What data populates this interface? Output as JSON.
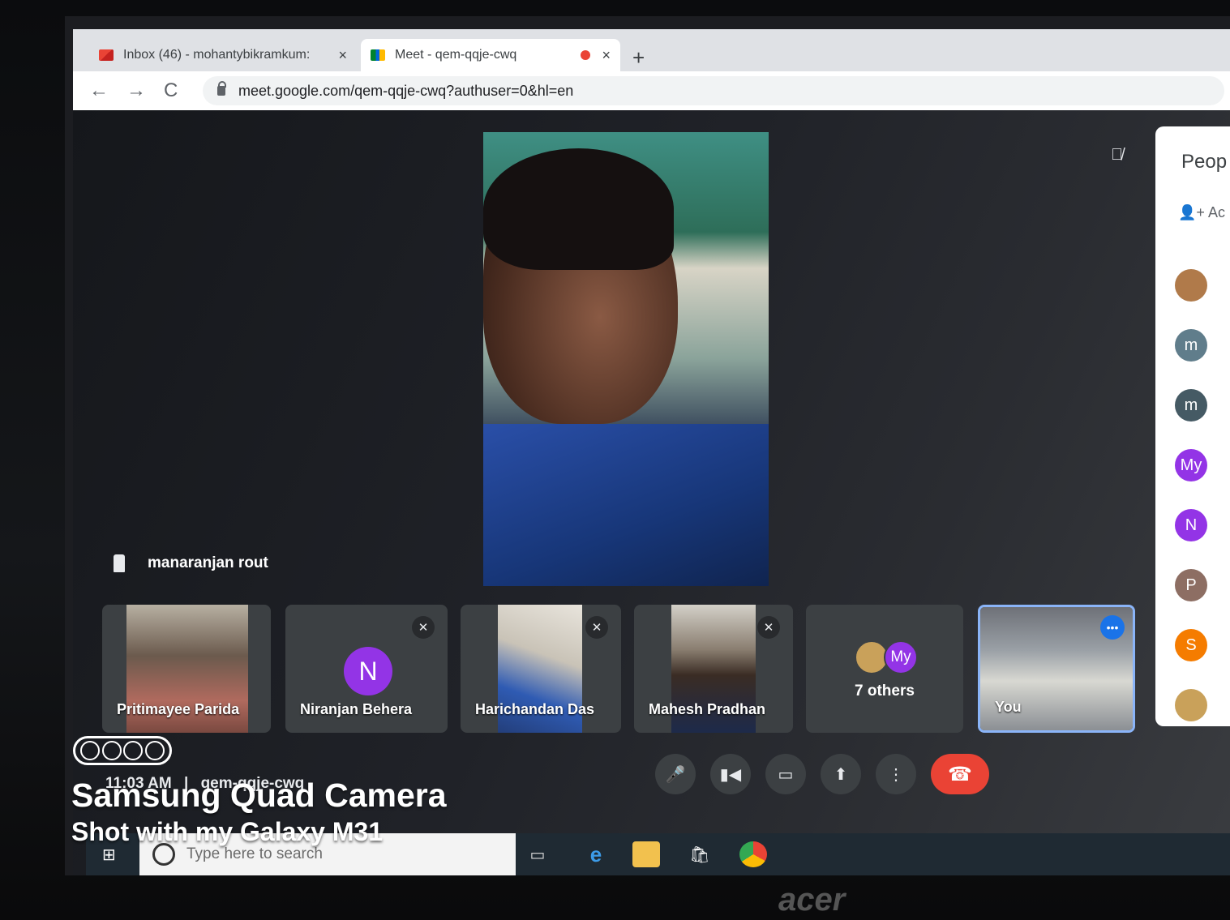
{
  "browser": {
    "tabs": [
      {
        "title": "Inbox (46) - mohantybikramkum:",
        "close": "×"
      },
      {
        "title": "Meet - qem-qqje-cwq",
        "close": "×"
      }
    ],
    "new_tab": "+",
    "nav": {
      "back": "←",
      "forward": "→",
      "reload": "C"
    },
    "url": "meet.google.com/qem-qqje-cwq?authuser=0&hl=en"
  },
  "meet": {
    "pinned_name": "manaranjan rout",
    "tiles": [
      {
        "name": "Pritimayee Parida"
      },
      {
        "name": "Niranjan Behera",
        "initial": "N"
      },
      {
        "name": "Harichandan Das"
      },
      {
        "name": "Mahesh Pradhan"
      },
      {
        "others_label": "7 others",
        "avatar_text": "My"
      },
      {
        "name": "You",
        "menu": "•••"
      }
    ],
    "meeting_time": "11:03 AM",
    "meeting_code": "qem-qqje-cwq"
  },
  "people_panel": {
    "title": "Peop",
    "add_label": "Ac",
    "avatars": [
      {
        "text": "",
        "color": "#b07a4a"
      },
      {
        "text": "m",
        "color": "#607d8b"
      },
      {
        "text": "m",
        "color": "#455a64"
      },
      {
        "text": "My",
        "color": "#9334e6"
      },
      {
        "text": "N",
        "color": "#9334e6"
      },
      {
        "text": "P",
        "color": "#8d6e63"
      },
      {
        "text": "S",
        "color": "#f57c00"
      },
      {
        "text": "",
        "color": "#c9a15a"
      }
    ]
  },
  "taskbar": {
    "search_placeholder": "Type here to search"
  },
  "monitor_brand": "acer",
  "watermark": {
    "title": "Samsung Quad Camera",
    "subtitle": "Shot with my Galaxy M31"
  },
  "colors": {
    "meet_red": "#ea4335",
    "meet_blue": "#1a73e8",
    "tile_bg": "#3c4043",
    "avatar_purple": "#9334e6"
  }
}
